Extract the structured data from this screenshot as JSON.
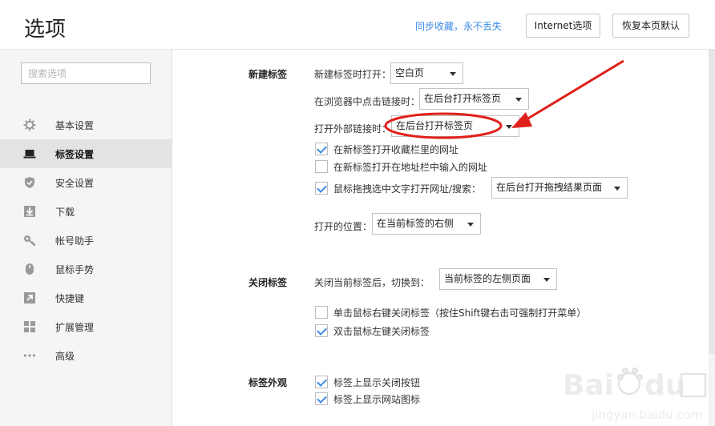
{
  "header": {
    "title": "选项",
    "sync_link": "同步收藏，永不丢失",
    "internet_button": "Internet选项",
    "restore_button": "恢复本页默认"
  },
  "sidebar": {
    "search_placeholder": "搜索选项",
    "items": [
      {
        "label": "基本设置",
        "icon": "gear-icon"
      },
      {
        "label": "标签设置",
        "icon": "laptop-icon",
        "active": true
      },
      {
        "label": "安全设置",
        "icon": "shield-icon"
      },
      {
        "label": "下载",
        "icon": "download-icon"
      },
      {
        "label": "帐号助手",
        "icon": "key-icon"
      },
      {
        "label": "鼠标手势",
        "icon": "mouse-icon"
      },
      {
        "label": "快捷键",
        "icon": "arrow-icon"
      },
      {
        "label": "扩展管理",
        "icon": "grid-icon"
      },
      {
        "label": "高级",
        "icon": "more-icon"
      }
    ]
  },
  "new_tab": {
    "title": "新建标签",
    "open_new_tab_label": "新建标签时打开：",
    "open_new_tab_value": "空白页",
    "click_link_label": "在浏览器中点击链接时：",
    "click_link_value": "在后台打开标签页",
    "external_link_label": "打开外部链接时：",
    "external_link_value": "在后台打开标签页",
    "cb_favorites_label": "在新标签打开收藏栏里的网址",
    "cb_favorites_checked": true,
    "cb_address_label": "在新标签打开在地址栏中输入的网址",
    "cb_address_checked": false,
    "cb_drag_label": "鼠标拖拽选中文字打开网址/搜索：",
    "cb_drag_checked": true,
    "drag_value": "在后台打开拖拽结果页面",
    "position_label": "打开的位置：",
    "position_value": "在当前标签的右侧"
  },
  "close_tab": {
    "title": "关闭标签",
    "switch_label": "关闭当前标签后，切换到：",
    "switch_value": "当前标签的左侧页面",
    "cb_right_click_label": "单击鼠标右键关闭标签（按住Shift键右击可强制打开菜单）",
    "cb_right_click_checked": false,
    "cb_double_click_label": "双击鼠标左键关闭标签",
    "cb_double_click_checked": true
  },
  "tab_appearance": {
    "title": "标签外观",
    "cb_close_button_label": "标签上显示关闭按钮",
    "cb_close_button_checked": true,
    "cb_site_icon_label": "标签上显示网站图标",
    "cb_site_icon_checked": true
  },
  "colors": {
    "accent": "#3d8ae6",
    "annotation_red": "#e0201b",
    "sidebar_bg": "#f5f5f5",
    "active_bg": "#e3e3e3"
  }
}
